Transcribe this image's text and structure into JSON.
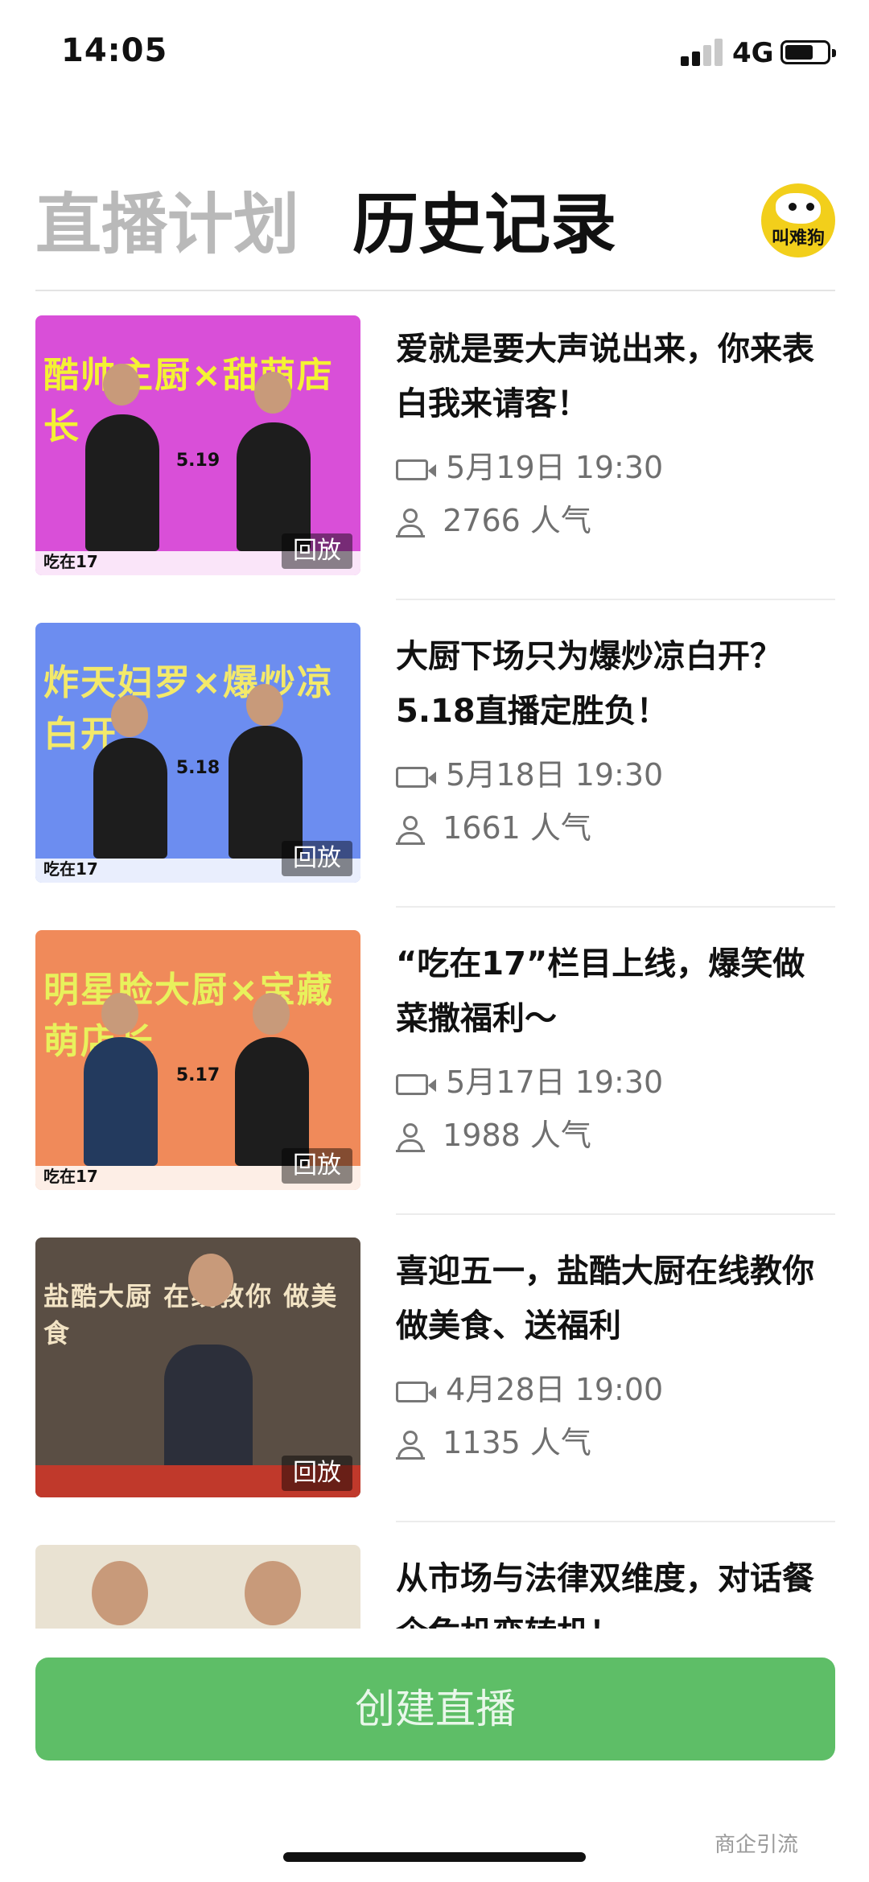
{
  "status_bar": {
    "time": "14:05",
    "network": "4G"
  },
  "tabs": [
    {
      "label": "直播计划",
      "active": false
    },
    {
      "label": "历史记录",
      "active": true
    }
  ],
  "avatar": {
    "text": "叫难狗",
    "color": "#f2cf1b"
  },
  "items": [
    {
      "title": "爱就是要大声说出来，你来表白我来请客！",
      "time": "5月19日 19:30",
      "popularity": "2766 人气",
      "thumb_headline": "酷帅主厨×甜萌店长",
      "thumb_date": "5.19",
      "thumb_bg": "#d94fd8",
      "thumb_text_color": "#f4f233",
      "replay": "回放"
    },
    {
      "title": "大厨下场只为爆炒凉白开？5.18直播定胜负！",
      "time": "5月18日 19:30",
      "popularity": "1661 人气",
      "thumb_headline": "炸天妇罗×爆炒凉白开",
      "thumb_date": "5.18",
      "thumb_bg": "#6c8df0",
      "thumb_text_color": "#f3e96a",
      "replay": "回放"
    },
    {
      "title": "“吃在17”栏目上线，爆笑做菜撒福利～",
      "time": "5月17日 19:30",
      "popularity": "1988 人气",
      "thumb_headline": "明星脸大厨×宝藏萌店长",
      "thumb_date": "5.17",
      "thumb_bg": "#f08a5a",
      "thumb_text_color": "#e8f15c",
      "replay": "回放"
    },
    {
      "title": "喜迎五一，盐酷大厨在线教你做美食、送福利",
      "time": "4月28日 19:00",
      "popularity": "1135 人气",
      "thumb_headline": "盐酷大厨 在线教你 做美食",
      "thumb_date": "",
      "thumb_bg": "#5a4e44",
      "thumb_text_color": "#f2e3c4",
      "replay": "回放"
    },
    {
      "title": "从市场与法律双维度，对话餐企危机变转机！",
      "time": "",
      "popularity": "",
      "thumb_headline": "",
      "thumb_date": "",
      "thumb_bg": "#e9e2d2",
      "thumb_text_color": "#c43a1e",
      "replay": ""
    }
  ],
  "create_button": "创建直播",
  "watermark": "商企引流",
  "colors": {
    "accent_green": "#5ebe67",
    "active_tab": "#111111",
    "inactive_tab": "#b9b9b9"
  }
}
